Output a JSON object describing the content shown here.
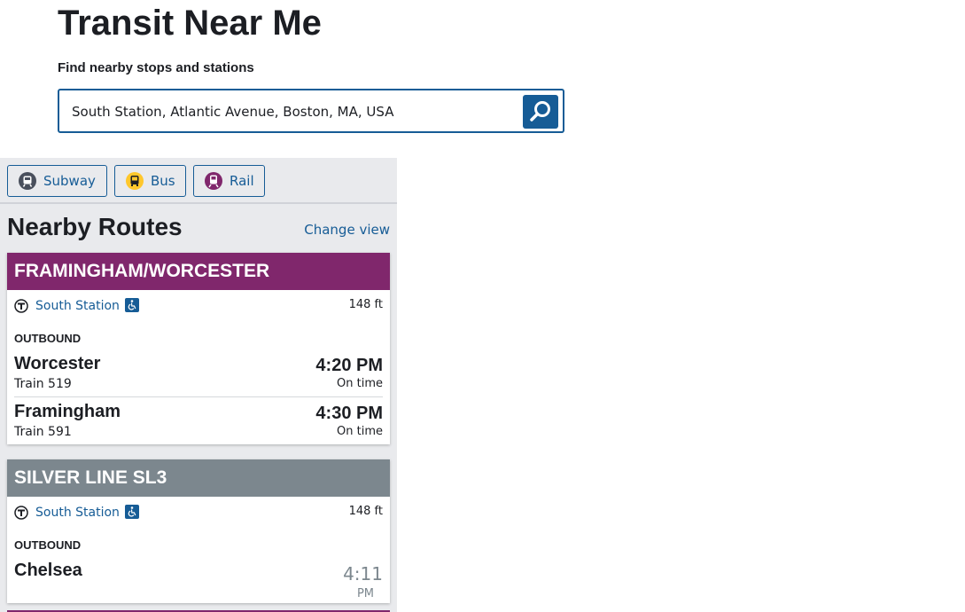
{
  "page": {
    "title": "Transit Near Me",
    "search_label": "Find nearby stops and stations",
    "search_value": "South Station, Atlantic Avenue, Boston, MA, USA"
  },
  "mode_filters": [
    {
      "label": "Subway",
      "icon": "subway-icon",
      "color": "#494f5c"
    },
    {
      "label": "Bus",
      "icon": "bus-icon",
      "color": "#ffc72c"
    },
    {
      "label": "Rail",
      "icon": "commuter-rail-icon",
      "color": "#80276c"
    }
  ],
  "routes_panel": {
    "title": "Nearby Routes",
    "change_view": "Change view"
  },
  "routes": [
    {
      "name": "FRAMINGHAM/WORCESTER",
      "color": "#80276c",
      "stop": "South Station",
      "distance": "148 ft",
      "direction": "OUTBOUND",
      "trips": [
        {
          "destination": "Worcester",
          "train": "Train 519",
          "time": "4:20 PM",
          "status": "On time"
        },
        {
          "destination": "Framingham",
          "train": "Train 591",
          "time": "4:30 PM",
          "status": "On time"
        }
      ]
    },
    {
      "name": "SILVER LINE SL3",
      "color": "#7c878e",
      "stop": "South Station",
      "distance": "148 ft",
      "direction": "OUTBOUND",
      "trips": [
        {
          "destination": "Chelsea",
          "time": "4:11",
          "ampm": "PM"
        }
      ]
    }
  ],
  "colors": {
    "accent": "#165c96",
    "panel_bg": "#e9eaed",
    "commuter_rail": "#80276c",
    "silver_line": "#7c878e"
  }
}
